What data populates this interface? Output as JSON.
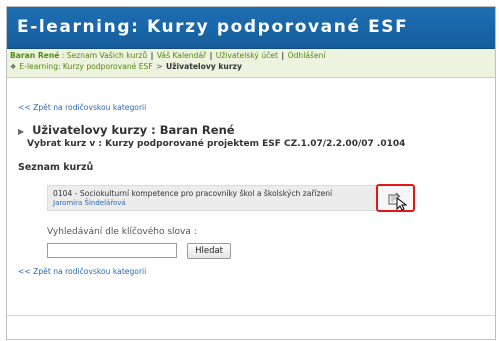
{
  "header": {
    "title": "E-learning: Kurzy podporované ESF"
  },
  "userbar": {
    "user": "Baran René",
    "links": [
      "Seznam Vašich kurzů",
      "Váš Kalendář",
      "Uživatelský účet",
      "Odhlášení"
    ],
    "separator_first": ":",
    "separator": "|"
  },
  "breadcrumb": {
    "home": "E-learning: Kurzy podporované ESF",
    "arrow": ">",
    "current": "Uživatelovy kurzy"
  },
  "content": {
    "back_link": "<< Zpět na rodičovskou kategorii",
    "heading": "Uživatelovy kurzy : Baran René",
    "subheading": "Vybrat kurz v : Kurzy podporované projektem ESF CZ.1.07/2.2.00/07 .0104",
    "section_title": "Seznam kurzů",
    "course": {
      "name": "0104 - Sociokulturní kompetence pro pracovníky škol a školských zařízení",
      "teacher": "Jaromíra Šindelářová"
    },
    "search": {
      "label": "Vyhledávání dle klíčového slova :",
      "value": "",
      "button": "Hledat"
    },
    "back_link_bottom": "<< Zpět na rodičovskou kategorii"
  },
  "icons": {
    "enrol": "enrol-icon",
    "cursor": "mouse-pointer-icon",
    "home": "home-icon"
  },
  "colors": {
    "header_bg": "#1965a7",
    "link_green": "#4f8a10",
    "link_blue": "#2a6ab0",
    "highlight_red": "#e11818"
  }
}
